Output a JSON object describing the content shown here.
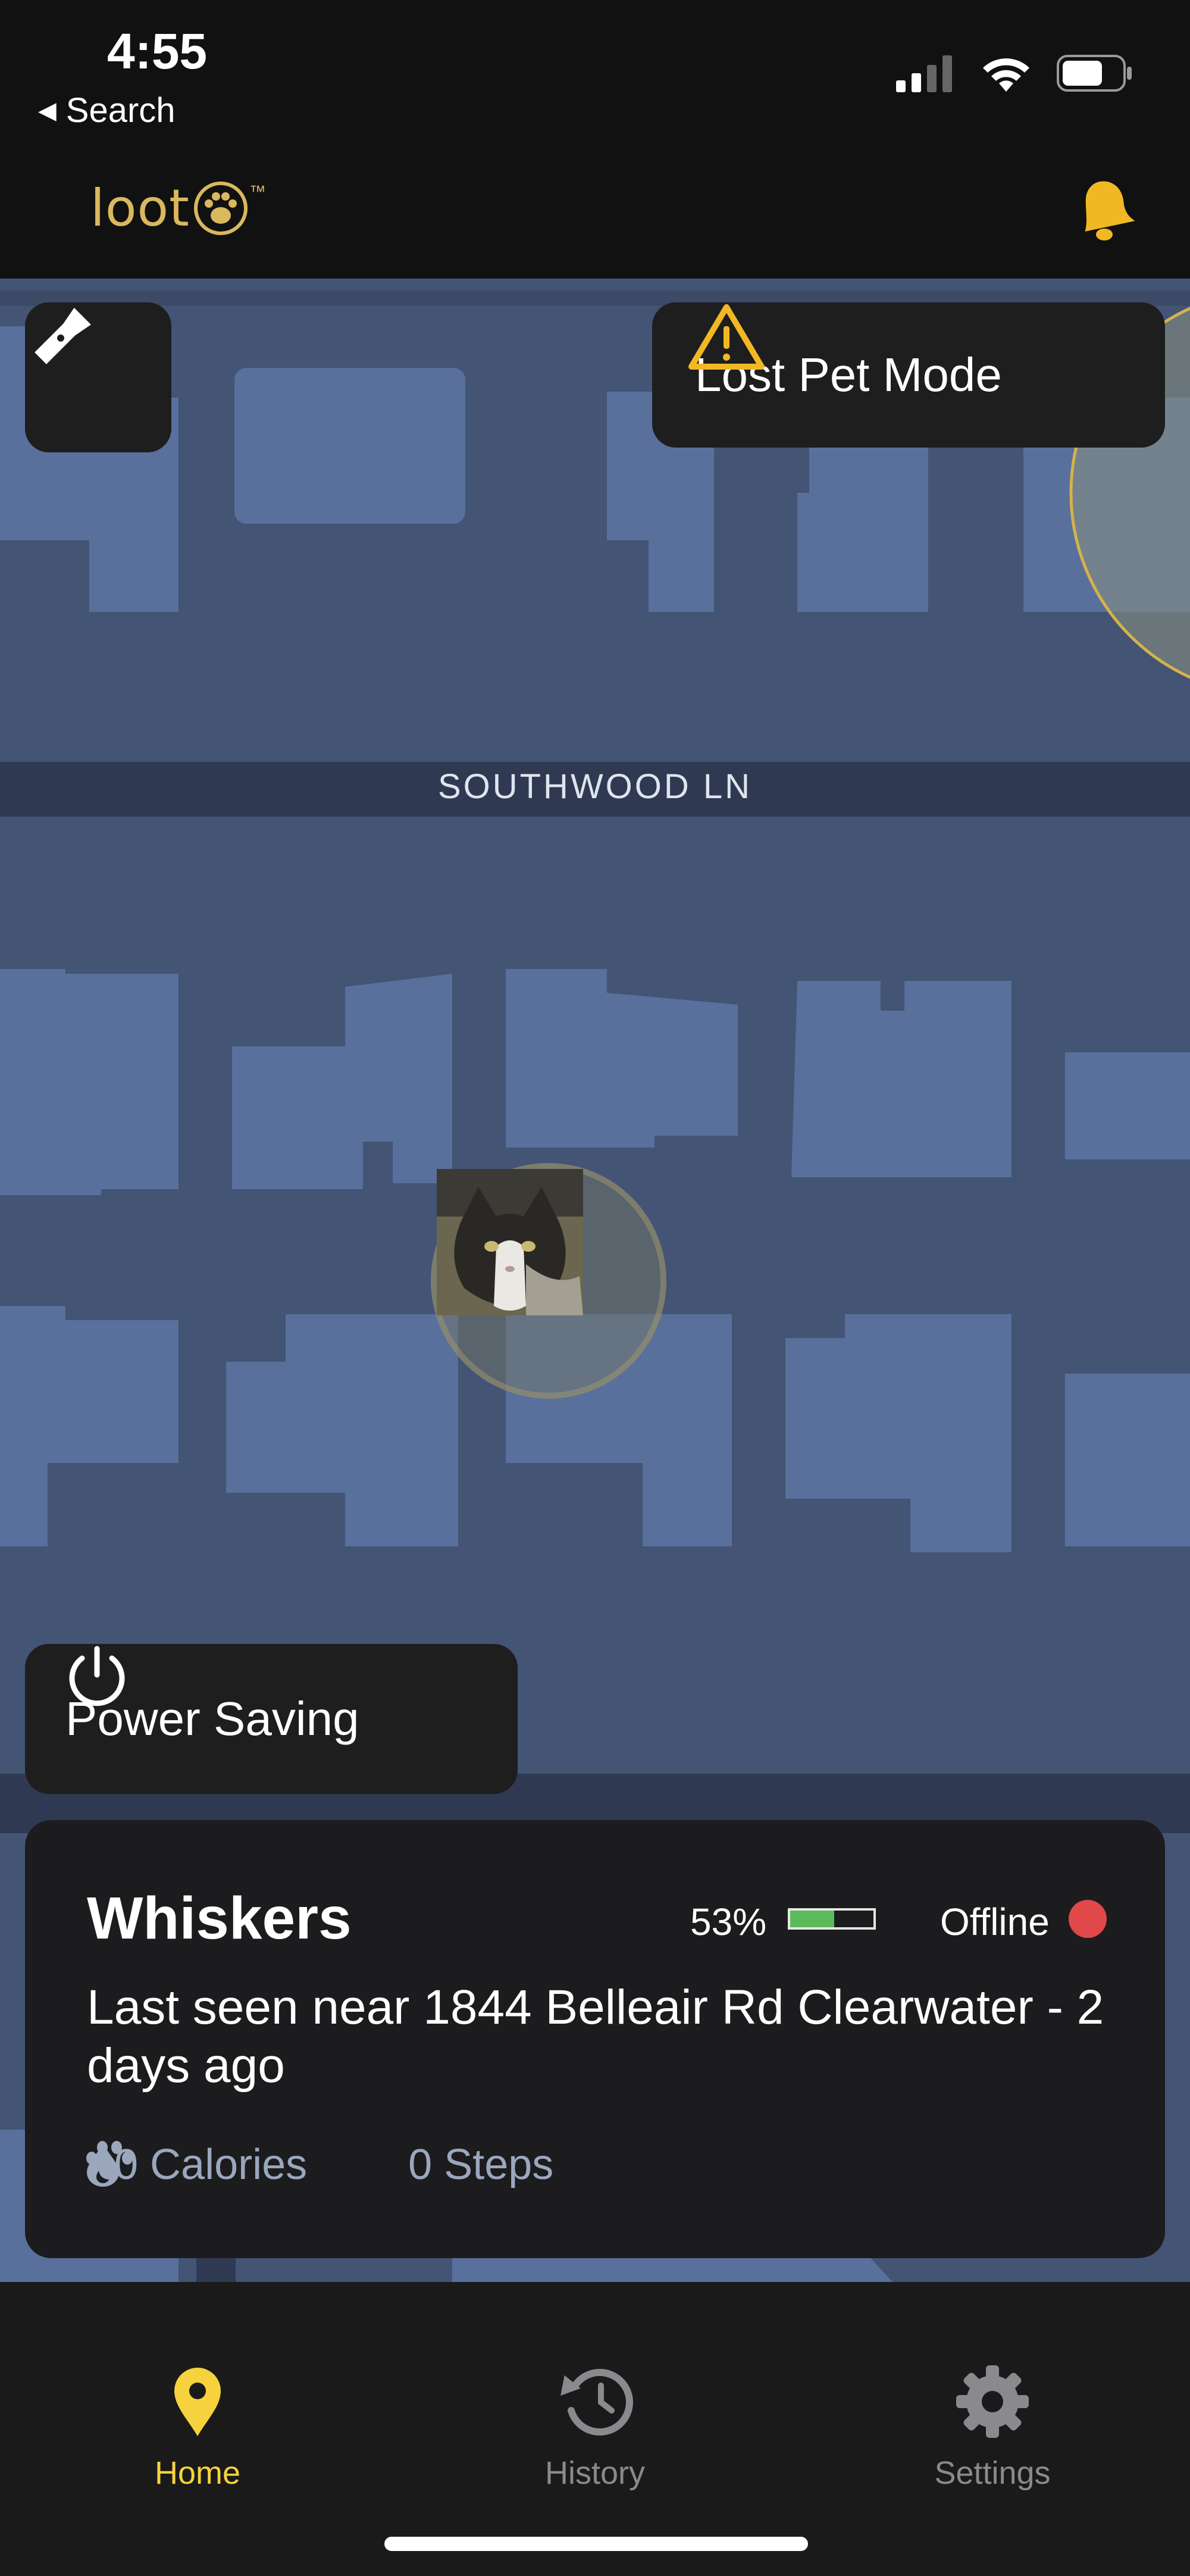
{
  "status_bar": {
    "time": "4:55",
    "back_label": "Search"
  },
  "header": {
    "logo_text": "loot",
    "logo_trademark": "™",
    "bell_icon": "bell-icon"
  },
  "map": {
    "street_name": "SOUTHWOOD LN",
    "flashlight_icon": "flashlight-icon",
    "lost_pet_label": "Lost Pet Mode",
    "power_saving_label": "Power Saving"
  },
  "pet_card": {
    "name": "Whiskers",
    "battery_percent": "53%",
    "battery_level": 0.53,
    "connection_status": "Offline",
    "status_color": "#e0484a",
    "last_seen": "Last seen near 1844 Belleair Rd Clearwater - 2 days ago",
    "calories": "0 Calories",
    "steps": "0 Steps"
  },
  "nav": {
    "items": [
      {
        "label": "Home",
        "icon": "map-pin-icon",
        "active": true
      },
      {
        "label": "History",
        "icon": "history-icon",
        "active": false
      },
      {
        "label": "Settings",
        "icon": "gear-icon",
        "active": false
      }
    ],
    "accent_color": "#f5d23e",
    "inactive_color": "#8a8a8e"
  },
  "colors": {
    "brand_gold": "#d9b85e",
    "map_bg": "#435474",
    "building": "#58709b"
  }
}
